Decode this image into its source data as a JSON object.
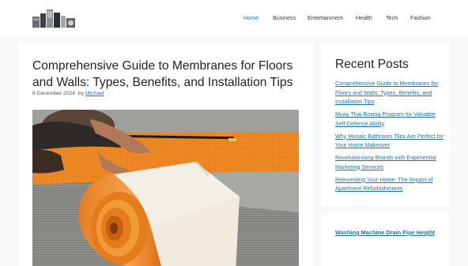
{
  "nav": {
    "items": [
      "Home",
      "Business",
      "Entertainment",
      "Health",
      "Tech",
      "Fashion"
    ],
    "active": "Home"
  },
  "post": {
    "title": "Comprehensive Guide to Membranes for Floors and Walls: Types, Benefits, and Installation Tips",
    "date": "6 December 2024",
    "by": "by",
    "author": "Michael"
  },
  "sidebar": {
    "recent_title": "Recent Posts",
    "recent_posts": [
      "Comprehensive Guide to Membranes for Floors and Walls: Types, Benefits, and Installation Tips",
      "Muay Thai Boxing Program for Valuable Self-Defense Ability",
      "Why Mosaic Bathroom Tiles Are Perfect for Your Home Makeover",
      "Revolutionising Brands with Experiential Marketing Services",
      "Reinventing Your Home: The Impact of Apartment Refurbishments"
    ],
    "widget2_link": "Washing Machine Drain Pipe Height"
  },
  "colors": {
    "accent": "#1e73be",
    "background": "#f7f8f9",
    "membrane": "#f08a24"
  },
  "icons": {
    "logo": "appliances-logo-icon"
  }
}
